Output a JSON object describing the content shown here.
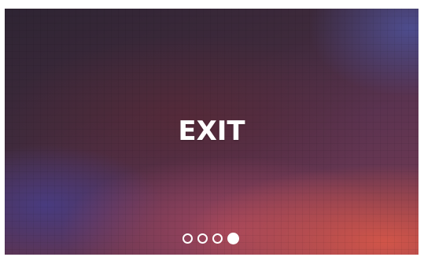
{
  "screen": {
    "title": "EXIT"
  },
  "pager": {
    "total": 4,
    "active_index": 3
  }
}
